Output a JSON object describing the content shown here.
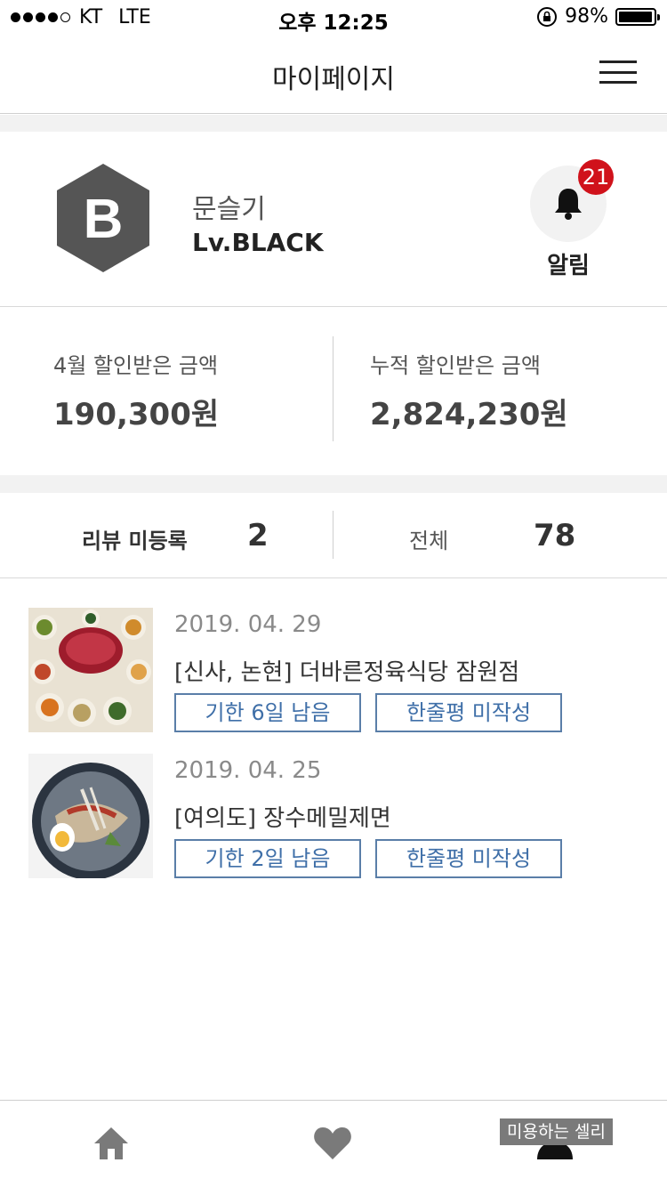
{
  "status_bar": {
    "carrier": "KT",
    "network": "LTE",
    "time": "오후 12:25",
    "battery_percent": "98%",
    "battery_level": 0.98
  },
  "navbar": {
    "title": "마이페이지",
    "menu_icon": "hamburger-menu-icon"
  },
  "profile": {
    "avatar_letter": "B",
    "avatar_color": "#555555",
    "name": "문슬기",
    "level": "Lv.BLACK",
    "alarm_label": "알림",
    "alarm_count": "21",
    "badge_color": "#d0121b"
  },
  "discount": {
    "monthly_label": "4월 할인받은 금액",
    "monthly_value": "190,300원",
    "total_label": "누적 할인받은 금액",
    "total_value": "2,824,230원"
  },
  "review_summary": {
    "pending_label": "리뷰 미등록",
    "pending_count": "2",
    "all_label": "전체",
    "all_count": "78"
  },
  "reviews": [
    {
      "date": "2019. 04. 29",
      "title": "[신사, 논현] 더바른정육식당 잠원점",
      "deadline": "기한 6일 남음",
      "action": "한줄평 미작성"
    },
    {
      "date": "2019. 04. 25",
      "title": "[여의도] 장수메밀제면",
      "deadline": "기한 2일 남음",
      "action": "한줄평 미작성"
    }
  ],
  "tabbar": {
    "home_icon": "home-icon",
    "favorite_icon": "heart-icon",
    "profile_icon": "person-icon",
    "tooltip": "미용하는 셀리"
  },
  "colors": {
    "accent_button_border": "#5a7ea8",
    "accent_button_text": "#3f6fa8"
  }
}
